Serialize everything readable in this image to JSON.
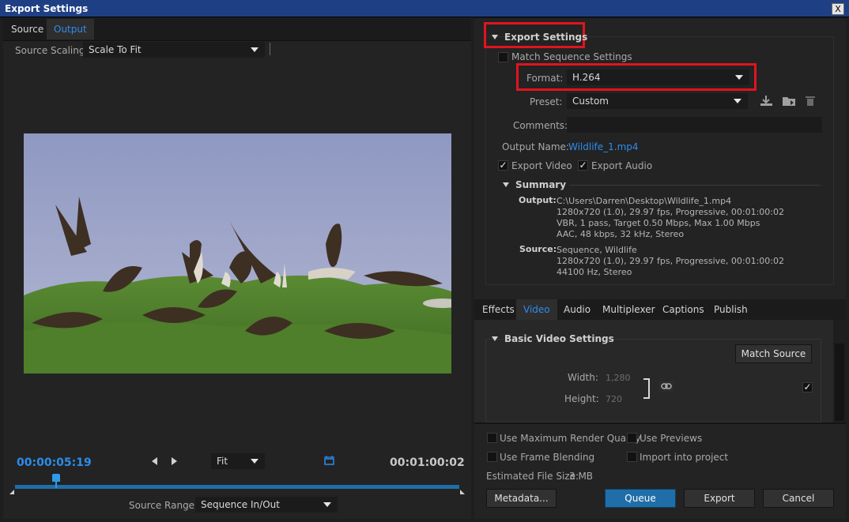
{
  "window": {
    "title": "Export Settings",
    "close": "X"
  },
  "left": {
    "tabs": [
      "Source",
      "Output"
    ],
    "source_scaling_label": "Source Scaling:",
    "source_scaling_value": "Scale To Fit",
    "timecode_current": "00:00:05:19",
    "fit_value": "Fit",
    "timecode_duration": "00:01:00:02",
    "source_range_label": "Source Range:",
    "source_range_value": "Sequence In/Out"
  },
  "export": {
    "section_title": "Export Settings",
    "match_sequence": "Match Sequence Settings",
    "format_label": "Format:",
    "format_value": "H.264",
    "preset_label": "Preset:",
    "preset_value": "Custom",
    "comments_label": "Comments:",
    "comments_value": "",
    "output_name_label": "Output Name:",
    "output_name_value": "Wildlife_1.mp4",
    "export_video": "Export Video",
    "export_audio": "Export Audio",
    "summary_title": "Summary",
    "output_label": "Output:",
    "output_lines": "C:\\Users\\Darren\\Desktop\\Wildlife_1.mp4\n1280x720 (1.0), 29.97 fps, Progressive, 00:01:00:02\nVBR, 1 pass, Target 0.50 Mbps, Max 1.00 Mbps\nAAC, 48 kbps, 32 kHz, Stereo",
    "source_label": "Source:",
    "source_lines": "Sequence, Wildlife\n1280x720 (1.0), 29.97 fps, Progressive, 00:01:00:02\n44100 Hz, Stereo"
  },
  "settings_tabs": [
    "Effects",
    "Video",
    "Audio",
    "Multiplexer",
    "Captions",
    "Publish"
  ],
  "video": {
    "section_title": "Basic Video Settings",
    "match_source": "Match Source",
    "width_label": "Width:",
    "width_value": "1,280",
    "height_label": "Height:",
    "height_value": "720"
  },
  "bottom": {
    "max_render": "Use Maximum Render Quality",
    "use_previews": "Use Previews",
    "frame_blending": "Use Frame Blending",
    "import_project": "Import into project",
    "file_size_label": "Estimated File Size:",
    "file_size_value": "3 MB",
    "metadata": "Metadata...",
    "queue": "Queue",
    "export": "Export",
    "cancel": "Cancel"
  },
  "colors": {
    "accent": "#2d8ceb",
    "highlight": "#e0141e",
    "queue": "#1f6ea8"
  }
}
